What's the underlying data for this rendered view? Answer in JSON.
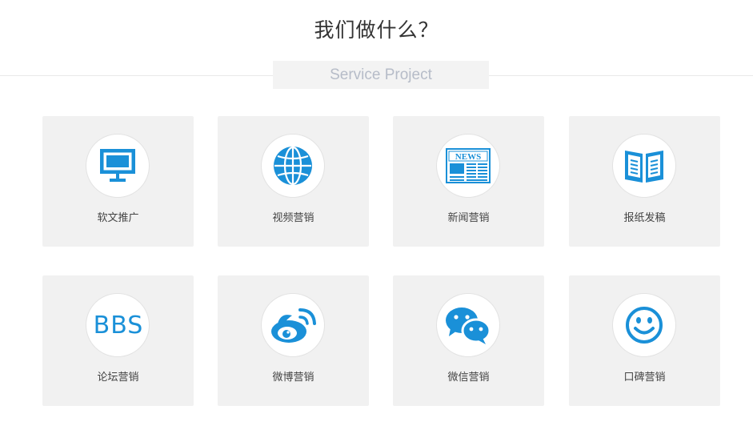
{
  "header": {
    "title": "我们做什么？",
    "subtitle": "Service Project"
  },
  "colors": {
    "accent": "#1a90d8",
    "card_bg": "#f1f1f1",
    "subtitle_text": "#b6bcc8"
  },
  "services": [
    {
      "label": "软文推广",
      "icon": "monitor-icon"
    },
    {
      "label": "视频营销",
      "icon": "globe-icon"
    },
    {
      "label": "新闻营销",
      "icon": "newspaper-icon",
      "icon_text": "NEWS"
    },
    {
      "label": "报纸发稿",
      "icon": "open-book-icon"
    },
    {
      "label": "论坛营销",
      "icon": "bbs-icon",
      "icon_text": "BBS"
    },
    {
      "label": "微博营销",
      "icon": "weibo-icon"
    },
    {
      "label": "微信营销",
      "icon": "wechat-icon"
    },
    {
      "label": "口碑营销",
      "icon": "smiley-icon"
    }
  ]
}
